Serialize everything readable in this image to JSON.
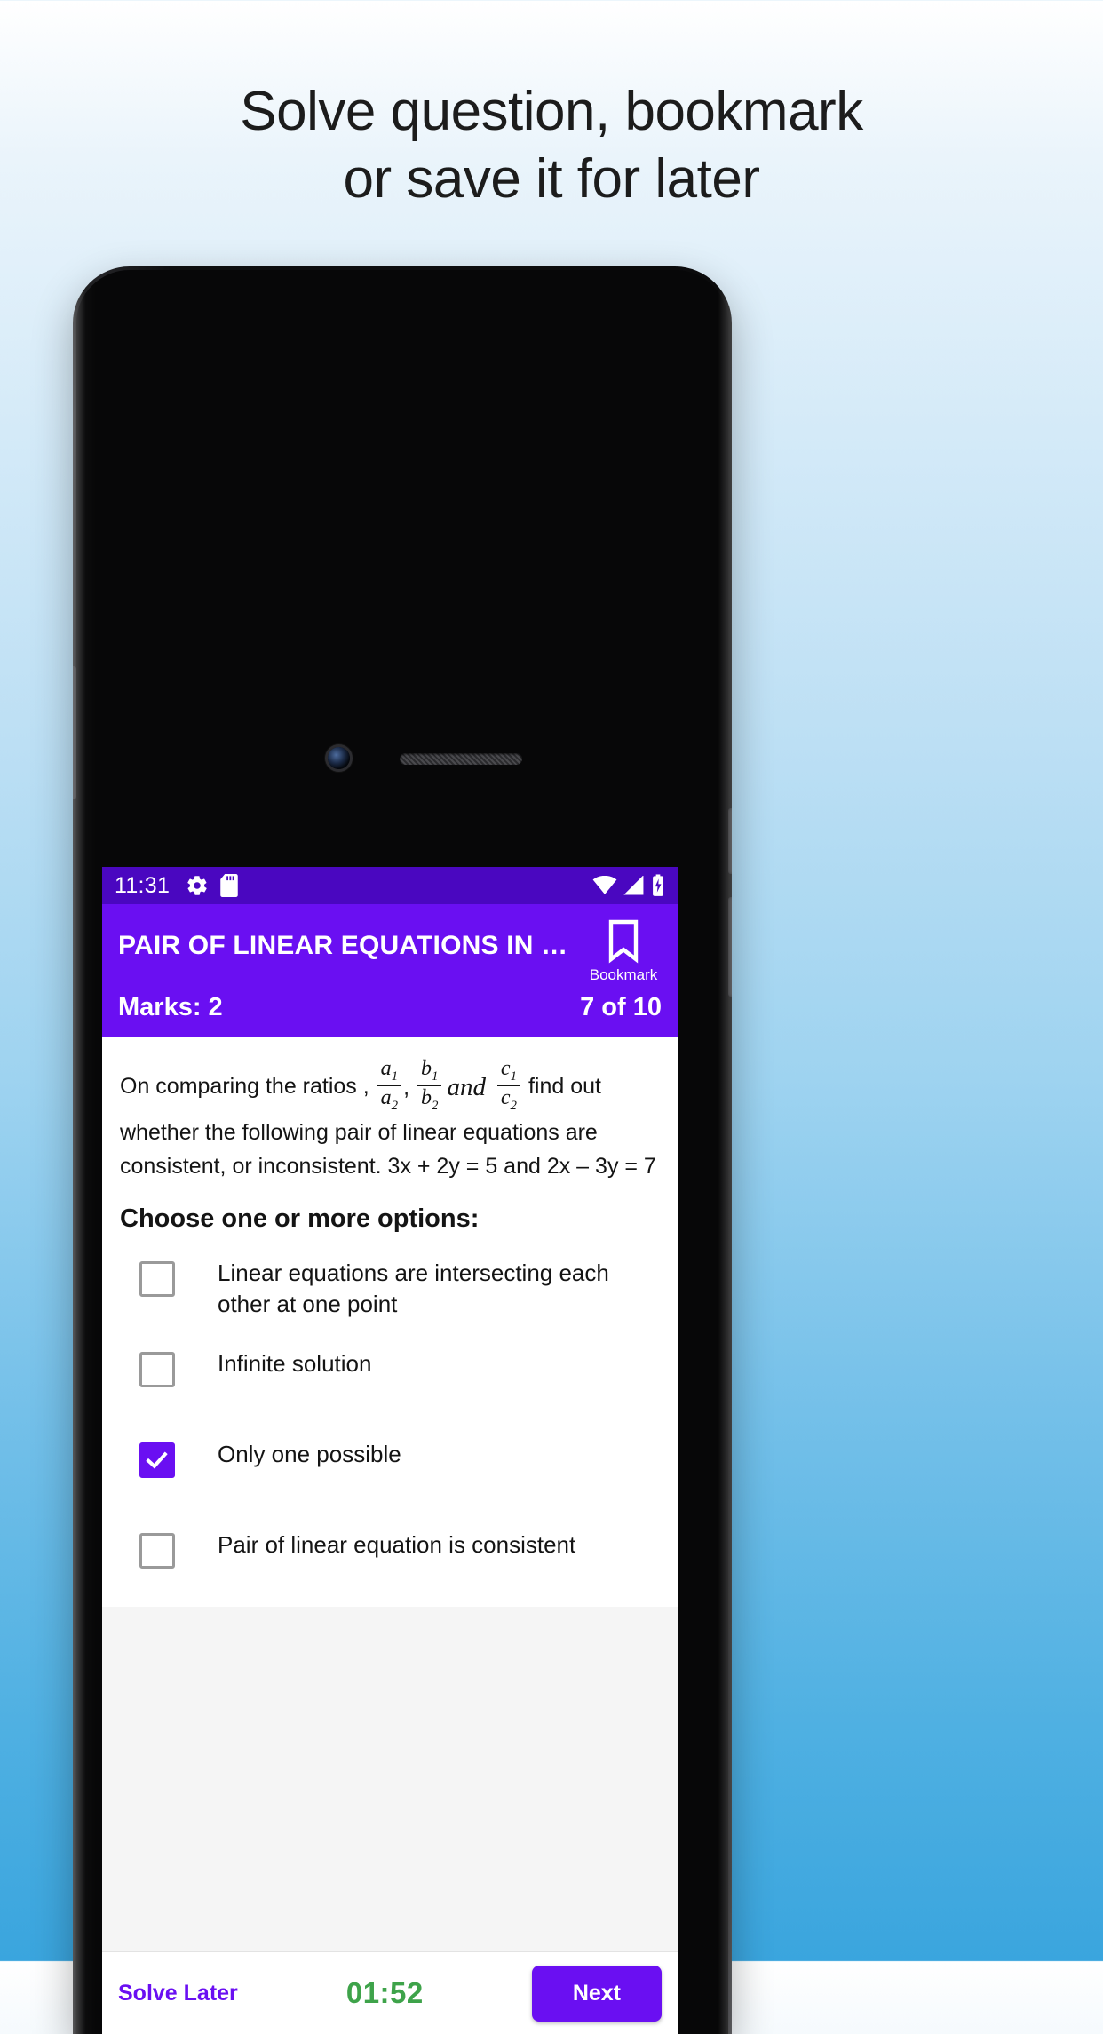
{
  "headline": {
    "line1": "Solve question, bookmark",
    "line2": "or save it for later"
  },
  "phone": {
    "status_bar": {
      "time": "11:31",
      "left_icons": [
        "gear-icon",
        "sd-card-icon"
      ],
      "right_icons": [
        "wifi-icon",
        "signal-icon",
        "battery-charging-icon"
      ],
      "background": "#4a07c0"
    },
    "app_bar": {
      "title": "PAIR OF LINEAR EQUATIONS IN …",
      "bookmark_label": "Bookmark",
      "background": "#6a0ff2"
    },
    "sub_bar": {
      "marks": "Marks: 2",
      "progress": "7 of 10"
    },
    "question": {
      "text_part1": "On comparing the ratios ,",
      "fraction1": {
        "num": "a",
        "num_sub": "1",
        "den": "a",
        "den_sub": "2"
      },
      "sep1": ",",
      "fraction2": {
        "num": "b",
        "num_sub": "1",
        "den": "b",
        "den_sub": "2"
      },
      "and_word": "and",
      "fraction3": {
        "num": "c",
        "num_sub": "1",
        "den": "c",
        "den_sub": "2"
      },
      "text_part2": "find out whether the following pair of linear equations are consistent, or inconsistent.  3x + 2y = 5  and 2x – 3y = 7"
    },
    "choose_prompt": "Choose one or more options:",
    "options": [
      {
        "label": "Linear equations are intersecting each other at one point",
        "checked": false
      },
      {
        "label": "Infinite solution",
        "checked": false
      },
      {
        "label": "Only one possible",
        "checked": true
      },
      {
        "label": "Pair of linear equation is consistent",
        "checked": false
      }
    ],
    "bottom_bar": {
      "solve_later": "Solve Later",
      "timer": "01:52",
      "next_label": "Next",
      "timer_color": "#3ea34a",
      "accent_color": "#6a0ff2"
    }
  }
}
